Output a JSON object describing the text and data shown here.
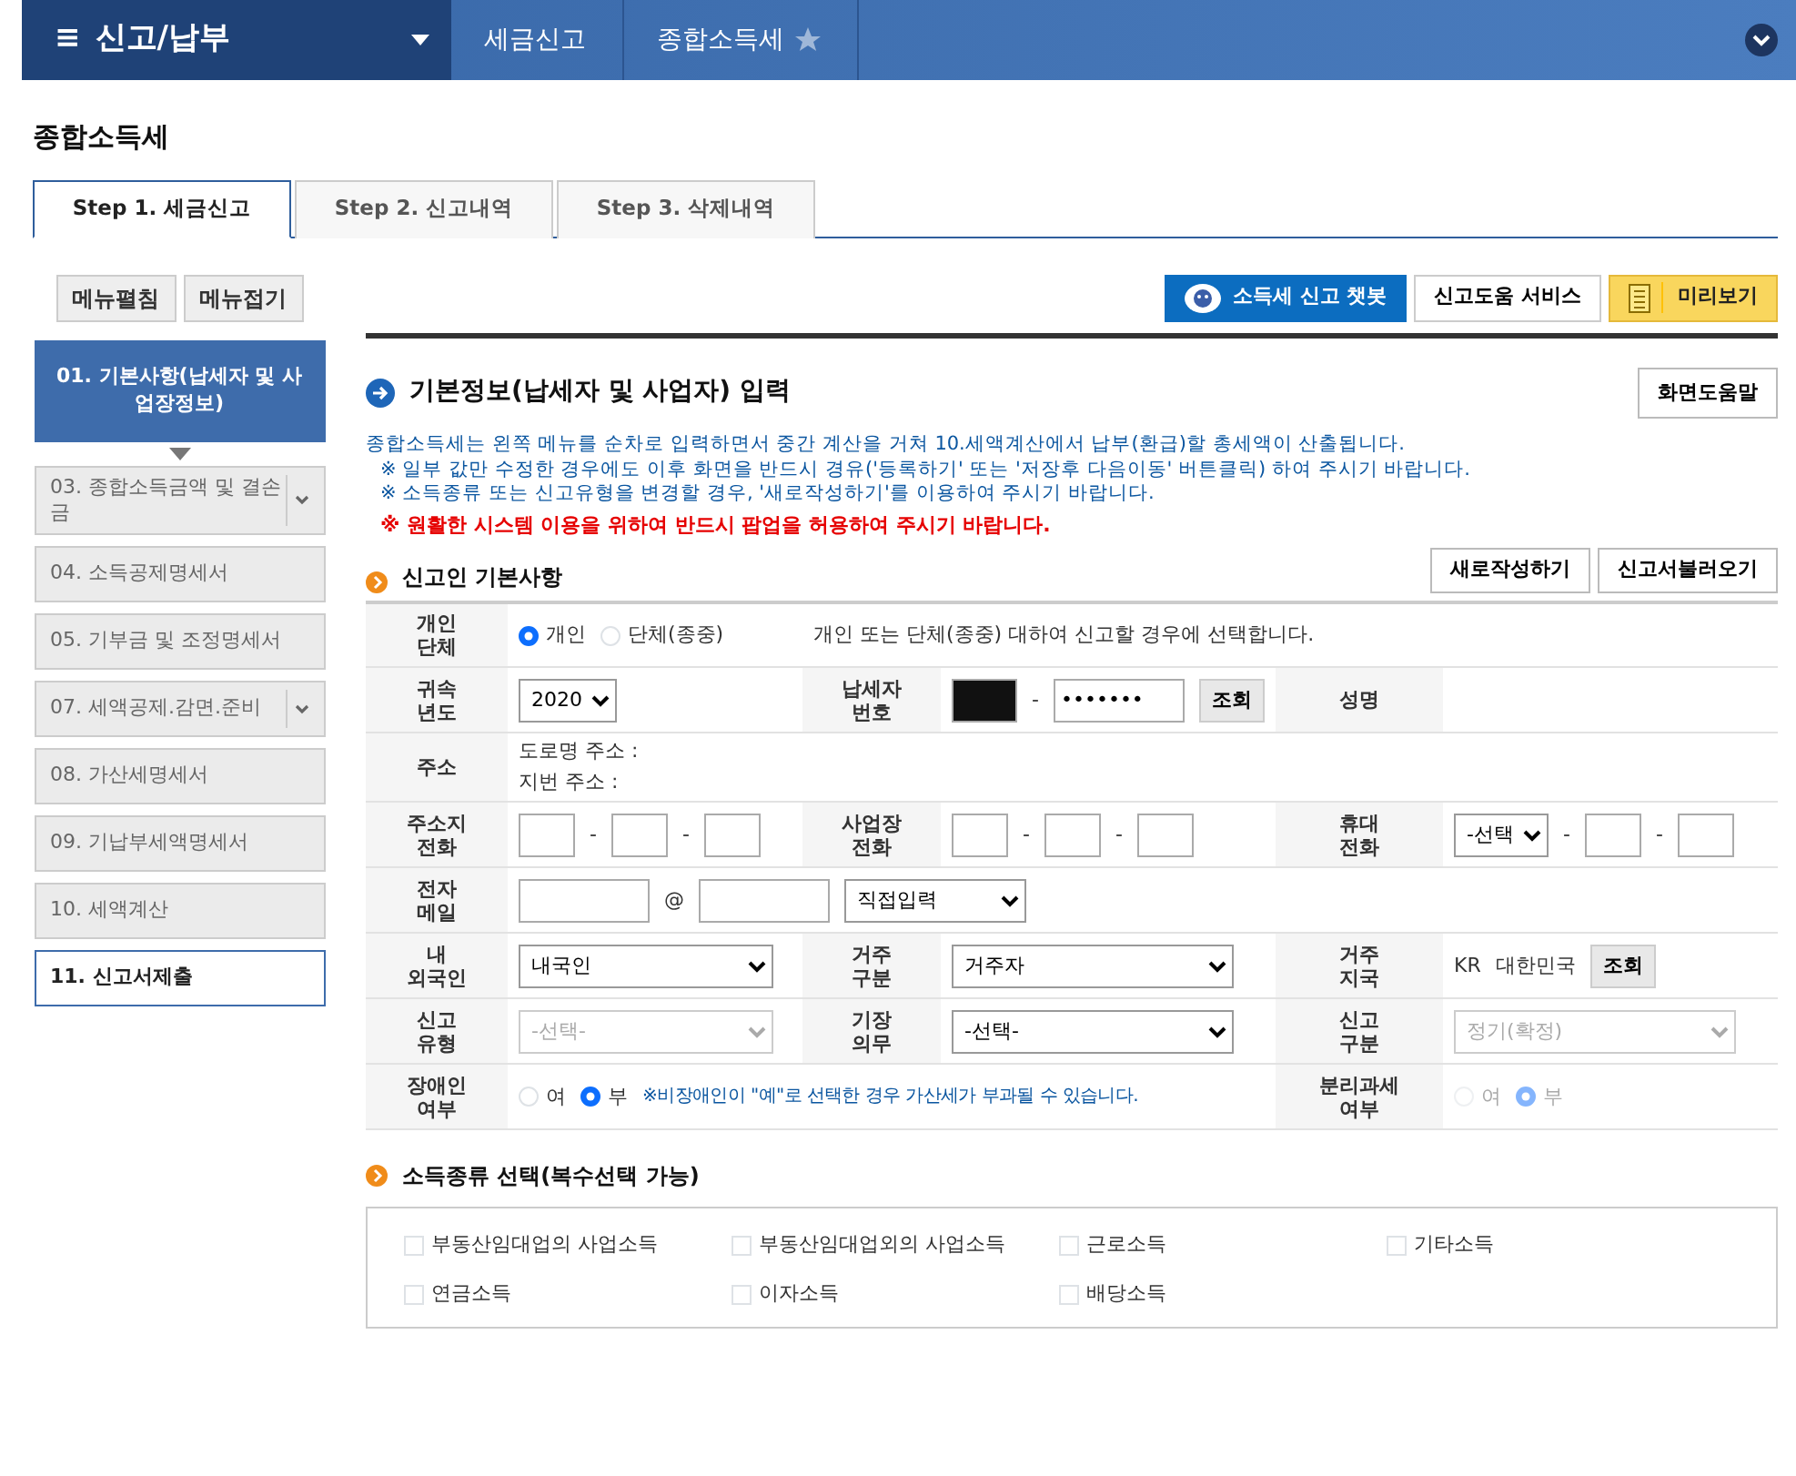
{
  "header": {
    "menu_icon": "≡",
    "menu_title": "신고/납부",
    "breadcrumbs": [
      "세금신고",
      "종합소득세"
    ]
  },
  "page_title": "종합소득세",
  "tabs": [
    {
      "label": "Step 1. 세금신고",
      "selected": true
    },
    {
      "label": "Step 2. 신고내역",
      "selected": false
    },
    {
      "label": "Step 3. 삭제내역",
      "selected": false
    }
  ],
  "sidebar": {
    "buttons": [
      "메뉴펼침",
      "메뉴접기"
    ],
    "items": [
      {
        "label": "01. 기본사항(납세자 및 사업장정보)",
        "selected": true,
        "kind": "plain",
        "emphasized": false
      },
      {
        "label": "03. 종합소득금액 및 결손금",
        "selected": false,
        "kind": "dropdown",
        "emphasized": false
      },
      {
        "label": "04. 소득공제명세서",
        "selected": false,
        "kind": "plain",
        "emphasized": false
      },
      {
        "label": "05. 기부금 및 조정명세서",
        "selected": false,
        "kind": "plain",
        "emphasized": false
      },
      {
        "label": "07. 세액공제.감면.준비",
        "selected": false,
        "kind": "dropdown",
        "emphasized": false
      },
      {
        "label": "08. 가산세명세서",
        "selected": false,
        "kind": "plain",
        "emphasized": false
      },
      {
        "label": "09. 기납부세액명세서",
        "selected": false,
        "kind": "plain",
        "emphasized": false
      },
      {
        "label": "10. 세액계산",
        "selected": false,
        "kind": "plain",
        "emphasized": false
      },
      {
        "label": "11. 신고서제출",
        "selected": false,
        "kind": "plain",
        "emphasized": true
      }
    ]
  },
  "top_buttons": [
    {
      "label": "소득세 신고 챗봇",
      "kind": "chatbot"
    },
    {
      "label": "신고도움 서비스",
      "kind": "plain"
    },
    {
      "label": "미리보기",
      "kind": "preview"
    }
  ],
  "heading": "기본정보(납세자 및 사업자) 입력",
  "help_button": "화면도움말",
  "notices": [
    {
      "text": "종합소득세는 왼쪽 메뉴를 순차로 입력하면서 중간 계산을 거쳐 10.세액계산에서 납부(환급)할 총세액이 산출됩니다.",
      "kind": "info"
    },
    {
      "text": "※ 일부 값만 수정한 경우에도 이후 화면을 반드시 경유('등록하기' 또는 '저장후 다음이동' 버튼클릭) 하여 주시기 바랍니다.",
      "kind": "info"
    },
    {
      "text": "※ 소득종류 또는 신고유형을 변경할 경우, '새로작성하기'를 이용하여 주시기 바랍니다.",
      "kind": "info"
    },
    {
      "text": "※ 원활한 시스템 이용을 위하여 반드시 팝업을 허용하여 주시기 바랍니다.",
      "kind": "warning"
    }
  ],
  "section_title": "신고인 기본사항",
  "section_buttons": [
    "새로작성하기",
    "신고서불러오기"
  ],
  "form_rows": [
    {
      "cells": [
        {
          "label": "개인\n단체"
        },
        {
          "items": [
            {
              "kind": "radio",
              "label": "개인",
              "selected": true,
              "disabled": false
            },
            {
              "kind": "radio",
              "label": "단체(종중)",
              "selected": false,
              "disabled": false
            }
          ]
        },
        {
          "items": [
            {
              "kind": "text",
              "text": "개인 또는 단체(종중) 대하여 신고할 경우에 선택합니다."
            }
          ]
        }
      ]
    },
    {
      "cells": [
        {
          "label": "귀속\n년도"
        },
        {
          "items": [
            {
              "kind": "select-short",
              "value": "2020",
              "disabled": false
            }
          ]
        },
        {
          "label": "납세자\n번호"
        },
        {
          "items": [
            {
              "kind": "redacted"
            },
            {
              "kind": "sep",
              "text": "-"
            },
            {
              "kind": "input",
              "value": "•••••••"
            },
            {
              "kind": "button",
              "text": "조회"
            }
          ]
        },
        {
          "label": "성명"
        },
        {}
      ]
    },
    {
      "cells": [
        {
          "label": "주소"
        },
        {
          "items": [
            {
              "kind": "text",
              "text": "도로명 주소 :"
            },
            {
              "kind": "text",
              "text": "지번 주소 :"
            }
          ]
        }
      ]
    },
    {
      "cells": [
        {
          "label": "주소지\n전화"
        },
        {
          "items": [
            {
              "kind": "input-short"
            },
            {
              "kind": "sep",
              "text": "-"
            },
            {
              "kind": "input-short"
            },
            {
              "kind": "sep",
              "text": "-"
            },
            {
              "kind": "input-short"
            }
          ]
        },
        {
          "label": "사업장\n전화"
        },
        {
          "items": [
            {
              "kind": "input-short"
            },
            {
              "kind": "sep",
              "text": "-"
            },
            {
              "kind": "input-short"
            },
            {
              "kind": "sep",
              "text": "-"
            },
            {
              "kind": "input-short"
            }
          ]
        },
        {
          "label": "휴대\n전화"
        },
        {
          "items": [
            {
              "kind": "select-short",
              "value": "-선택",
              "disabled": false
            },
            {
              "kind": "sep",
              "text": "-"
            },
            {
              "kind": "input-short"
            },
            {
              "kind": "sep",
              "text": "-"
            },
            {
              "kind": "input-short"
            }
          ]
        }
      ]
    },
    {
      "cells": [
        {
          "label": "전자\n메일"
        },
        {
          "items": [
            {
              "kind": "input"
            },
            {
              "kind": "sep",
              "text": "@"
            },
            {
              "kind": "input"
            },
            {
              "kind": "select-mid",
              "value": "직접입력",
              "disabled": false
            }
          ]
        }
      ]
    },
    {
      "cells": [
        {
          "label": "내\n외국인"
        },
        {
          "items": [
            {
              "kind": "select",
              "value": "내국인",
              "disabled": false
            }
          ]
        },
        {
          "label": "거주\n구분"
        },
        {
          "items": [
            {
              "kind": "select",
              "value": "거주자",
              "disabled": false
            }
          ]
        },
        {
          "label": "거주\n지국"
        },
        {
          "items": [
            {
              "kind": "text",
              "text": "KR"
            },
            {
              "kind": "text",
              "text": "대한민국"
            },
            {
              "kind": "button",
              "text": "조회"
            }
          ]
        }
      ]
    },
    {
      "cells": [
        {
          "label": "신고\n유형"
        },
        {
          "items": [
            {
              "kind": "select",
              "value": "-선택-",
              "disabled": true
            }
          ]
        },
        {
          "label": "기장\n의무"
        },
        {
          "items": [
            {
              "kind": "select",
              "value": "-선택-",
              "disabled": false
            }
          ]
        },
        {
          "label": "신고\n구분"
        },
        {
          "items": [
            {
              "kind": "select",
              "value": "정기(확정)",
              "disabled": true
            }
          ]
        }
      ]
    },
    {
      "cells": [
        {
          "label": "장애인\n여부"
        },
        {
          "items": [
            {
              "kind": "radio",
              "label": "여",
              "selected": false,
              "disabled": false
            },
            {
              "kind": "radio",
              "label": "부",
              "selected": true,
              "disabled": false
            },
            {
              "kind": "note",
              "text": "※비장애인이 \"예\"로 선택한 경우 가산세가 부과될 수 있습니다."
            }
          ]
        },
        {
          "label": "분리과세\n여부"
        },
        {
          "items": [
            {
              "kind": "radio",
              "label": "여",
              "selected": false,
              "disabled": true
            },
            {
              "kind": "radio",
              "label": "부",
              "selected": true,
              "disabled": true
            }
          ]
        }
      ]
    }
  ],
  "income_title": "소득종류 선택(복수선택 가능)",
  "income_types": [
    {
      "label": "부동산임대업의 사업소득",
      "checked": false
    },
    {
      "label": "부동산임대업외의 사업소득",
      "checked": false
    },
    {
      "label": "근로소득",
      "checked": false
    },
    {
      "label": "기타소득",
      "checked": false
    },
    {
      "label": "연금소득",
      "checked": false
    },
    {
      "label": "이자소득",
      "checked": false
    },
    {
      "label": "배당소득",
      "checked": false
    }
  ]
}
